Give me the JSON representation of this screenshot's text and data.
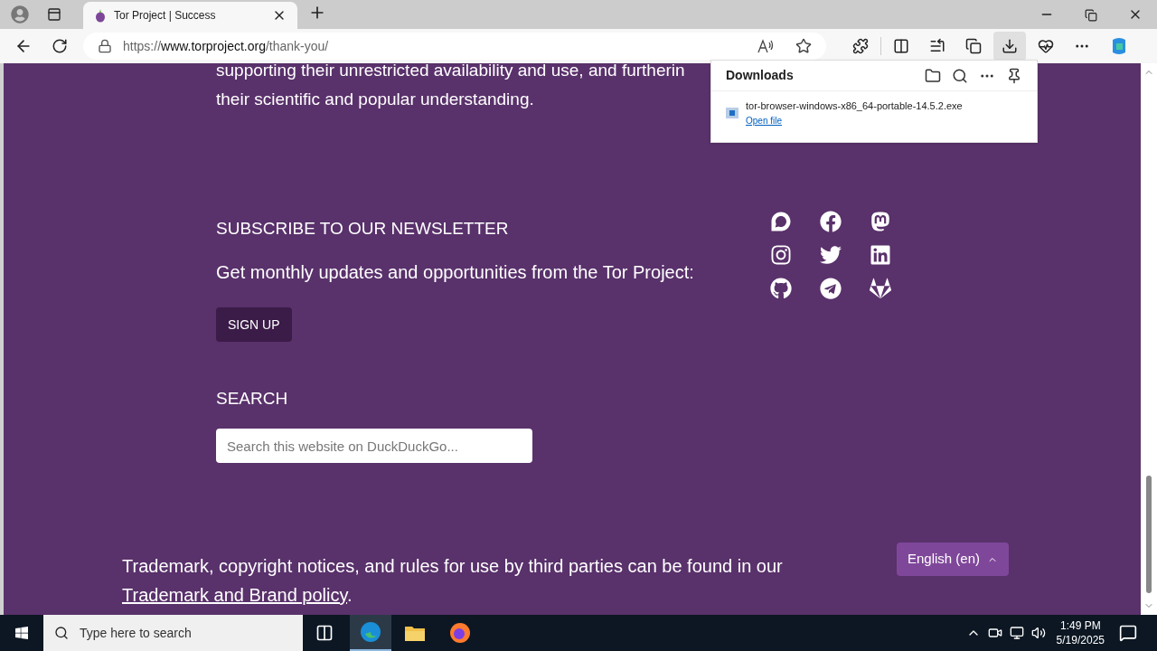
{
  "browser": {
    "tab": {
      "title": "Tor Project | Success",
      "selected": true
    },
    "url": {
      "scheme": "https://",
      "host": "www.torproject.org",
      "path": "/thank-you/"
    }
  },
  "downloads": {
    "title": "Downloads",
    "items": [
      {
        "file": "tor-browser-windows-x86_64-portable-14.5.2.exe",
        "action": "Open file"
      }
    ]
  },
  "page": {
    "intro_lines": [
      "supporting their unrestricted availability and use, and furtherin",
      "their scientific and popular understanding."
    ],
    "newsletter": {
      "heading": "SUBSCRIBE TO OUR NEWSLETTER",
      "text": "Get monthly updates and opportunities from the Tor Project:",
      "button": "SIGN UP"
    },
    "social": [
      {
        "kind": "discourse"
      },
      {
        "kind": "facebook"
      },
      {
        "kind": "mastodon"
      },
      {
        "kind": "instagram"
      },
      {
        "kind": "twitter"
      },
      {
        "kind": "linkedin"
      },
      {
        "kind": "github"
      },
      {
        "kind": "telegram"
      },
      {
        "kind": "gitlab"
      }
    ],
    "search": {
      "heading": "SEARCH",
      "placeholder": "Search this website on DuckDuckGo..."
    },
    "footer": {
      "text": "Trademark, copyright notices, and rules for use by third parties can be found in our",
      "link": "Trademark and Brand policy",
      "end": ".",
      "language": "English (en)"
    }
  },
  "taskbar": {
    "search_placeholder": "Type here to search",
    "time": "1:49 PM",
    "date": "5/19/2025"
  }
}
